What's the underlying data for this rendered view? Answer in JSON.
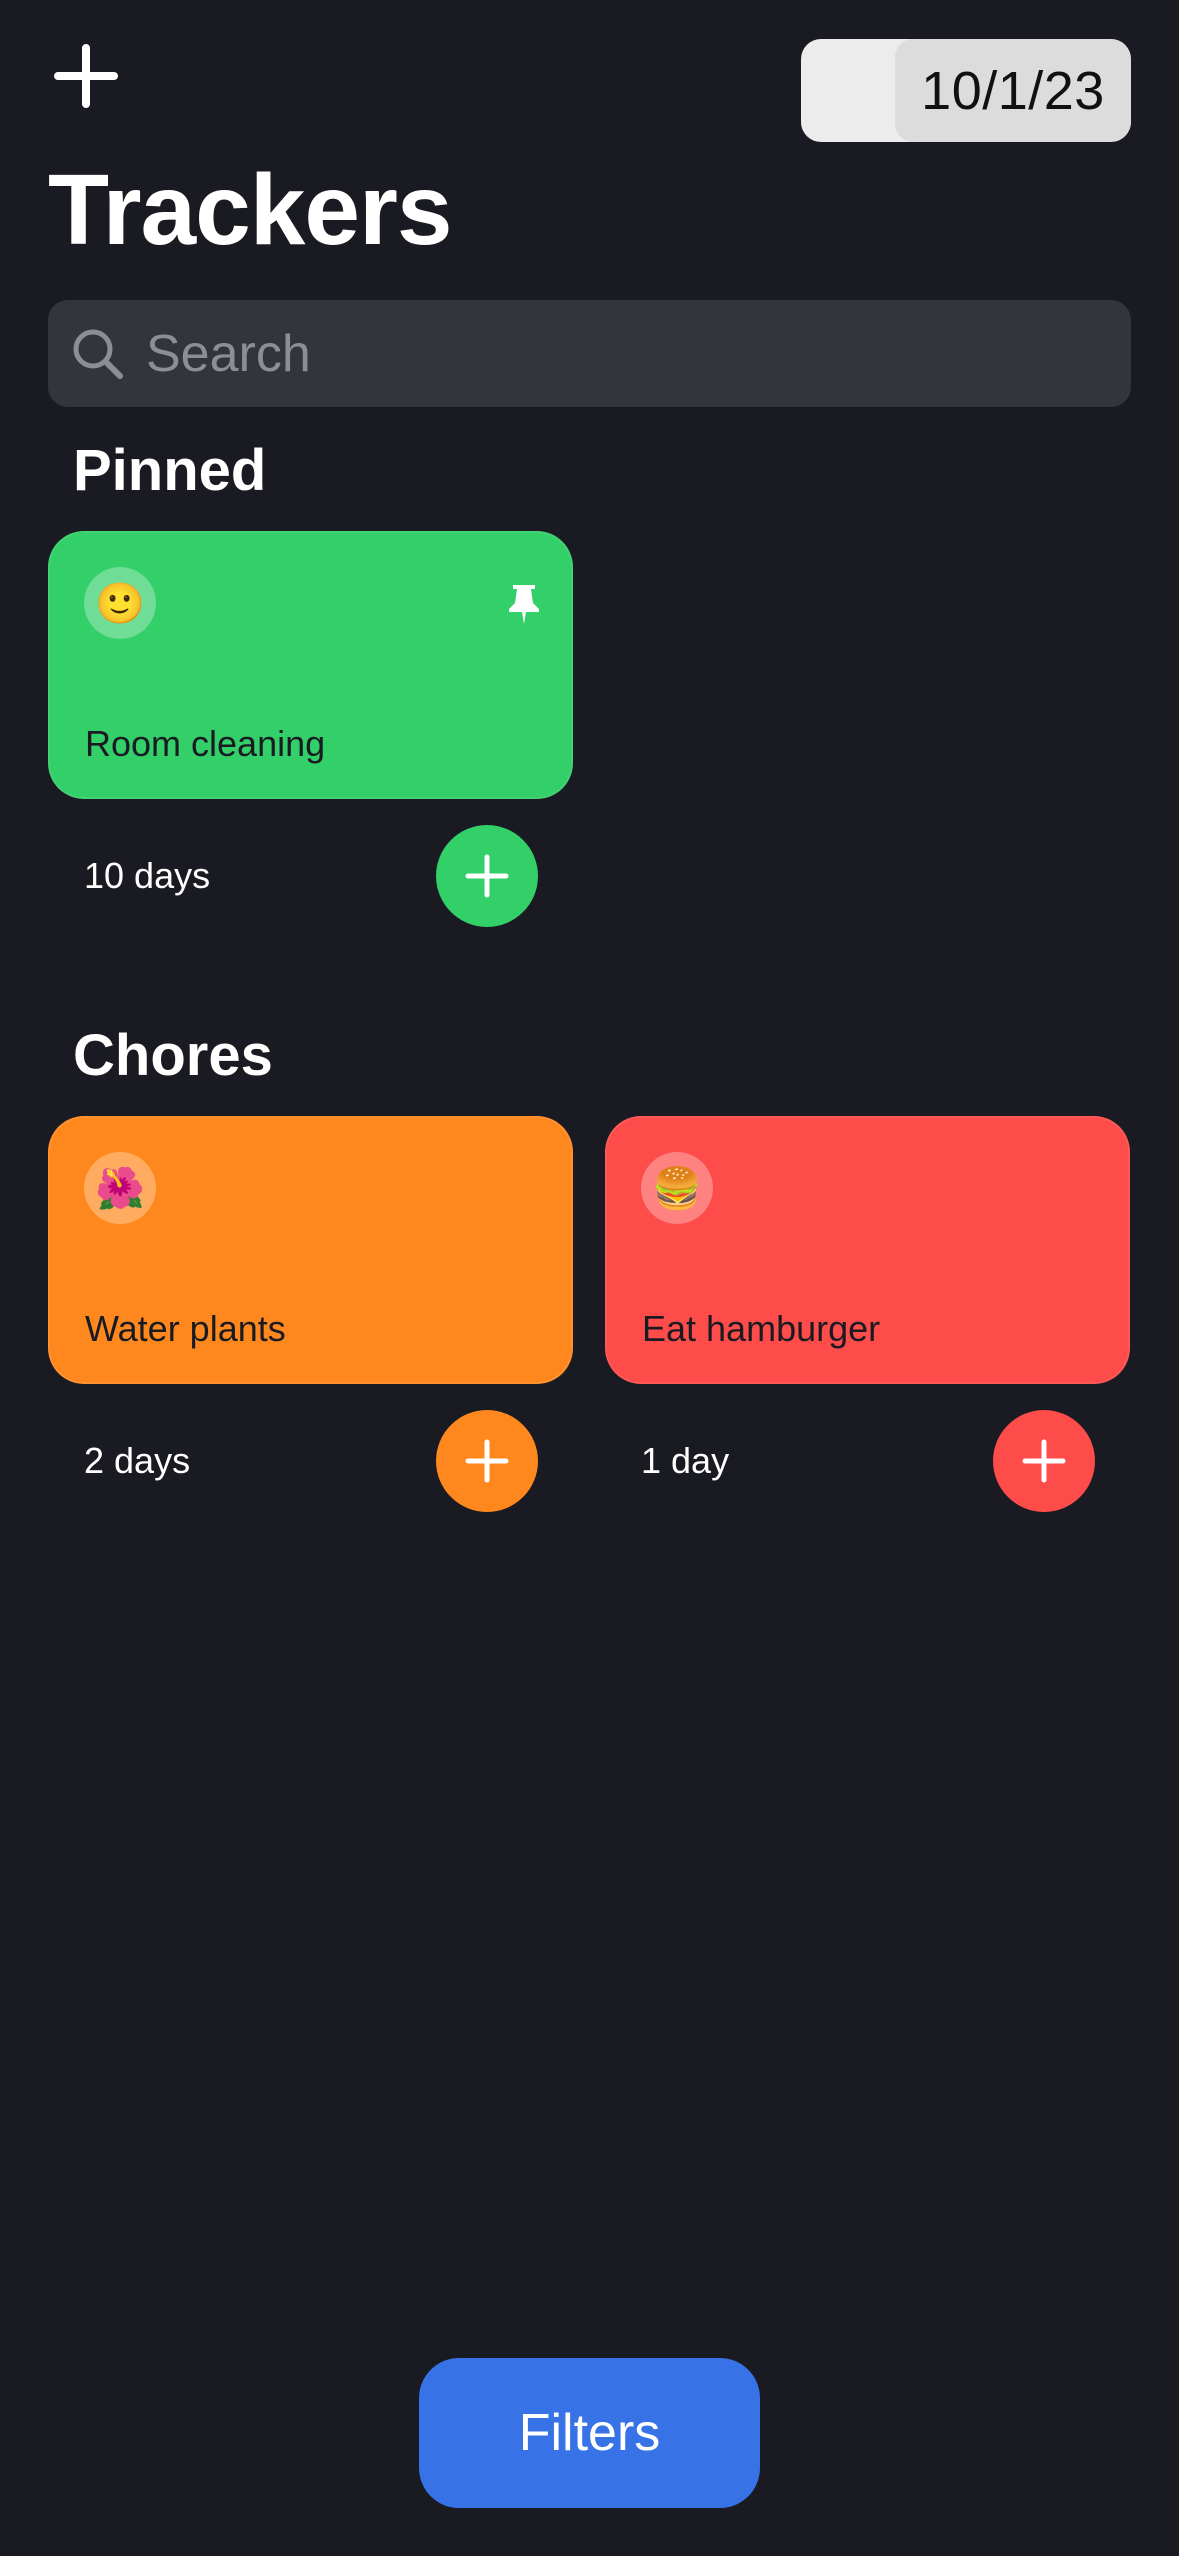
{
  "header": {
    "add_icon": "plus-icon",
    "date": "10/1/23",
    "title": "Trackers"
  },
  "search": {
    "placeholder": "Search",
    "icon": "magnifier-icon"
  },
  "sections": [
    {
      "title": "Pinned",
      "trackers": [
        {
          "emoji": "🙂",
          "name": "Room cleaning",
          "days": "10 days",
          "color": "#33cf69",
          "pinned": true
        }
      ]
    },
    {
      "title": "Chores",
      "trackers": [
        {
          "emoji": "🌺",
          "name": "Water plants",
          "days": "2 days",
          "color": "#ff881e",
          "pinned": false
        },
        {
          "emoji": "🍔",
          "name": "Eat hamburger",
          "days": "1 day",
          "color": "#fd4c49",
          "pinned": false
        }
      ]
    }
  ],
  "filters": {
    "label": "Filters",
    "color": "#3772e7"
  }
}
